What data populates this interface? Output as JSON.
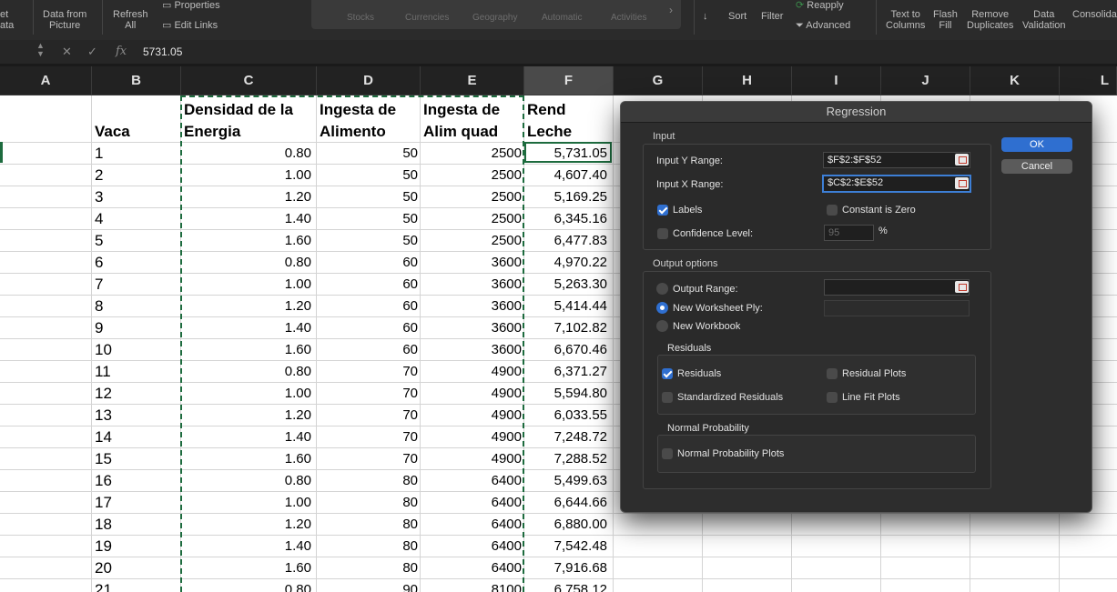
{
  "ribbon": {
    "get_data": [
      "et",
      "ata"
    ],
    "data_from_picture": [
      "Data from",
      "Picture"
    ],
    "refresh_all": [
      "Refresh",
      "All"
    ],
    "properties": "Properties",
    "edit_links": "Edit Links",
    "data_types": [
      "Stocks",
      "Currencies",
      "Geography",
      "Automatic",
      "Activities"
    ],
    "sort": "Sort",
    "filter": "Filter",
    "reapply": "Reapply",
    "advanced": "Advanced",
    "text_to_columns": [
      "Text to",
      "Columns"
    ],
    "flash_fill": [
      "Flash",
      "Fill"
    ],
    "remove_duplicates": [
      "Remove",
      "Duplicates"
    ],
    "data_validation": [
      "Data",
      "Validation"
    ],
    "consolidate": "Consolida"
  },
  "formula_bar": {
    "fx": "fx",
    "value": "5731.05"
  },
  "columns": [
    "A",
    "B",
    "C",
    "D",
    "E",
    "F",
    "G",
    "H",
    "I",
    "J",
    "K",
    "L"
  ],
  "headers": {
    "b": "Vaca",
    "c": [
      "Densidad de la",
      "Energia"
    ],
    "d": [
      "Ingesta de",
      "Alimento"
    ],
    "e": [
      "Ingesta de",
      "Alim quad"
    ],
    "f": [
      "Rend",
      "Leche"
    ]
  },
  "rows": [
    [
      "1",
      "0.80",
      "50",
      "2500",
      "5,731.05"
    ],
    [
      "2",
      "1.00",
      "50",
      "2500",
      "4,607.40"
    ],
    [
      "3",
      "1.20",
      "50",
      "2500",
      "5,169.25"
    ],
    [
      "4",
      "1.40",
      "50",
      "2500",
      "6,345.16"
    ],
    [
      "5",
      "1.60",
      "50",
      "2500",
      "6,477.83"
    ],
    [
      "6",
      "0.80",
      "60",
      "3600",
      "4,970.22"
    ],
    [
      "7",
      "1.00",
      "60",
      "3600",
      "5,263.30"
    ],
    [
      "8",
      "1.20",
      "60",
      "3600",
      "5,414.44"
    ],
    [
      "9",
      "1.40",
      "60",
      "3600",
      "7,102.82"
    ],
    [
      "10",
      "1.60",
      "60",
      "3600",
      "6,670.46"
    ],
    [
      "11",
      "0.80",
      "70",
      "4900",
      "6,371.27"
    ],
    [
      "12",
      "1.00",
      "70",
      "4900",
      "5,594.80"
    ],
    [
      "13",
      "1.20",
      "70",
      "4900",
      "6,033.55"
    ],
    [
      "14",
      "1.40",
      "70",
      "4900",
      "7,248.72"
    ],
    [
      "15",
      "1.60",
      "70",
      "4900",
      "7,288.52"
    ],
    [
      "16",
      "0.80",
      "80",
      "6400",
      "5,499.63"
    ],
    [
      "17",
      "1.00",
      "80",
      "6400",
      "6,644.66"
    ],
    [
      "18",
      "1.20",
      "80",
      "6400",
      "6,880.00"
    ],
    [
      "19",
      "1.40",
      "80",
      "6400",
      "7,542.48"
    ],
    [
      "20",
      "1.60",
      "80",
      "6400",
      "7,916.68"
    ],
    [
      "21",
      "0.80",
      "90",
      "8100",
      "6,758.12"
    ]
  ],
  "dialog": {
    "title": "Regression",
    "input_label": "Input",
    "y_range_label": "Input Y Range:",
    "y_range_value": "$F$2:$F$52",
    "x_range_label": "Input X Range:",
    "x_range_value": "$C$2:$E$52",
    "labels": "Labels",
    "constant_zero": "Constant is Zero",
    "confidence_level": "Confidence Level:",
    "confidence_value": "95",
    "percent": "%",
    "output_options": "Output options",
    "output_range": "Output Range:",
    "new_worksheet": "New Worksheet Ply:",
    "new_workbook": "New Workbook",
    "residuals_group": "Residuals",
    "residuals": "Residuals",
    "residual_plots": "Residual Plots",
    "standardized_residuals": "Standardized Residuals",
    "line_fit_plots": "Line Fit Plots",
    "normal_probability_group": "Normal Probability",
    "normal_probability_plots": "Normal Probability Plots",
    "ok": "OK",
    "cancel": "Cancel"
  },
  "colors": {
    "selection_green": "#1d6b3e",
    "accent_blue": "#2f6fd0",
    "dialog_bg": "#2d2d2d"
  }
}
